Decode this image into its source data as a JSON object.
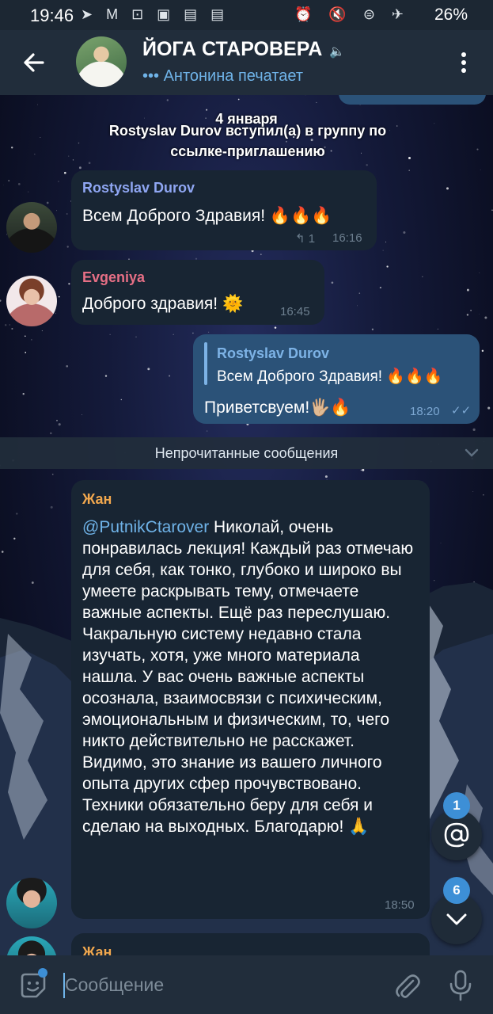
{
  "status_bar": {
    "time": "19:46",
    "left_icons": "➤ M ⊡ ▣ ▤ ▤",
    "right_icons": "⏰ 🔇 ⊜ ✈",
    "battery": "26%"
  },
  "header": {
    "title": "ЙОГА СТАРОВЕРА",
    "typing_status": "••• Антонина печатает",
    "mute_icon": "🔈"
  },
  "service": {
    "date": "4 января",
    "join_text": "Rostyslav Durov вступил(а) в группу по ссылке-приглашению"
  },
  "messages": [
    {
      "sender": "Rostyslav Durov",
      "sender_color": "#8fa6f2",
      "text": "Всем Доброго Здравия! 🔥🔥🔥",
      "reply_count": "↰ 1",
      "time": "16:16"
    },
    {
      "sender": "Evgeniya",
      "sender_color": "#e66f85",
      "text": "Доброго здравия! 🌞",
      "time": "16:45"
    },
    {
      "outgoing": true,
      "quote_sender": "Rostyslav Durov",
      "quote_text": "Всем Доброго Здравия! 🔥🔥🔥",
      "text": "Приветсвуем!🖐🏼🔥",
      "time": "18:20",
      "read_icon": "✓✓"
    },
    {
      "sender": "Жан",
      "sender_color": "#f2a84e",
      "mention": "@PutnikCtarover",
      "text": " Николай, очень понравилась лекция! Каждый раз отмечаю для себя, как тонко, глубоко и широко вы умеете раскрывать тему, отмечаете важные аспекты. Ещё раз переслушаю. Чакральную систему недавно стала изучать, хотя, уже много материала нашла. У вас очень важные аспекты осознала, взаимосвязи с психическим, эмоциональным и физическим, то, чего никто действительно не расскажет. Видимо, это знание из вашего личного опыта других сфер прочувствовано. Техники обязательно беру для себя и сделаю на выходных. Благодарю! 🙏",
      "time": "18:50"
    },
    {
      "sender": "Жан",
      "sender_color": "#f2a84e"
    }
  ],
  "unread_label": "Непрочитанные сообщения",
  "badges": {
    "mentions": "1",
    "unread": "6"
  },
  "input": {
    "placeholder": "Сообщение"
  },
  "colors": {
    "header_bg": "#212d3b",
    "incoming_bubble": "#182533",
    "outgoing_bubble": "#2b5278",
    "accent": "#3d8fd6",
    "link": "#6fb3e8"
  }
}
